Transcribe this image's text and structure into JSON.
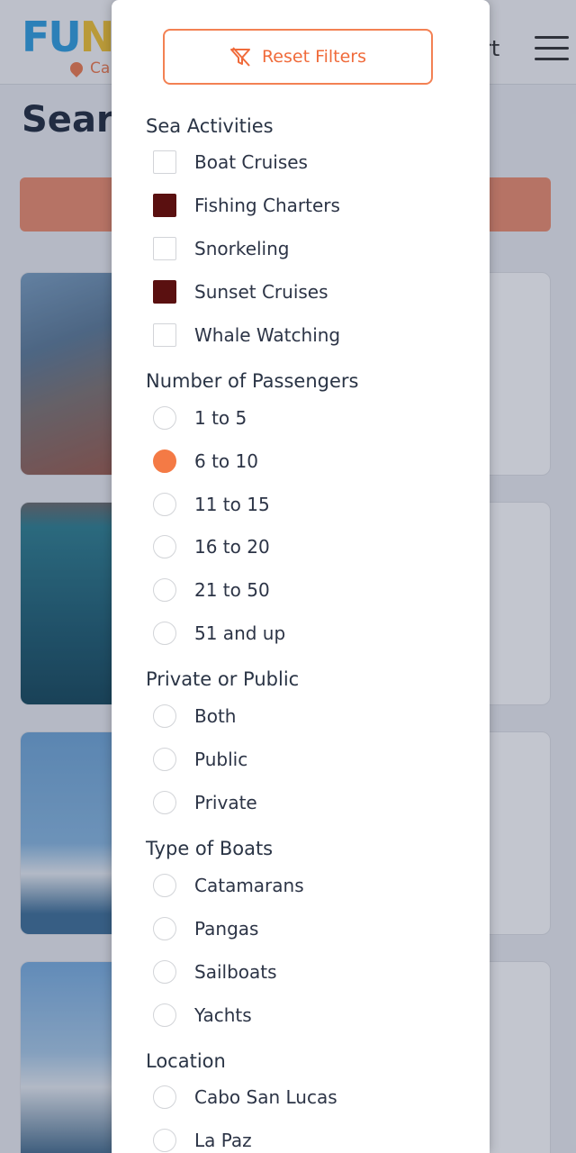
{
  "background": {
    "logo": {
      "part1": "FU",
      "part2": "N",
      "part3": "",
      "sublabel": "Ca"
    },
    "header_right_text": "rt",
    "page_title": "Searc"
  },
  "filters": {
    "reset_label": "Reset Filters",
    "sea_activities": {
      "title": "Sea Activities",
      "options": [
        {
          "label": "Boat Cruises",
          "checked": false
        },
        {
          "label": "Fishing Charters",
          "checked": true
        },
        {
          "label": "Snorkeling",
          "checked": false
        },
        {
          "label": "Sunset Cruises",
          "checked": true
        },
        {
          "label": "Whale Watching",
          "checked": false
        }
      ]
    },
    "passengers": {
      "title": "Number of Passengers",
      "options": [
        {
          "label": "1 to 5",
          "selected": false
        },
        {
          "label": "6 to 10",
          "selected": true
        },
        {
          "label": "11 to 15",
          "selected": false
        },
        {
          "label": "16 to 20",
          "selected": false
        },
        {
          "label": "21 to 50",
          "selected": false
        },
        {
          "label": "51 and up",
          "selected": false
        }
      ]
    },
    "privacy": {
      "title": "Private or Public",
      "options": [
        {
          "label": "Both",
          "selected": false
        },
        {
          "label": "Public",
          "selected": false
        },
        {
          "label": "Private",
          "selected": false
        }
      ]
    },
    "boat_types": {
      "title": "Type of Boats",
      "options": [
        {
          "label": "Catamarans",
          "selected": false
        },
        {
          "label": "Pangas",
          "selected": false
        },
        {
          "label": "Sailboats",
          "selected": false
        },
        {
          "label": "Yachts",
          "selected": false
        }
      ]
    },
    "location": {
      "title": "Location",
      "options": [
        {
          "label": "Cabo San Lucas",
          "selected": false
        },
        {
          "label": "La Paz",
          "selected": false
        }
      ]
    }
  },
  "colors": {
    "accent": "#f47a45",
    "checkbox_checked": "#5a1010",
    "overlay": "#283452"
  }
}
